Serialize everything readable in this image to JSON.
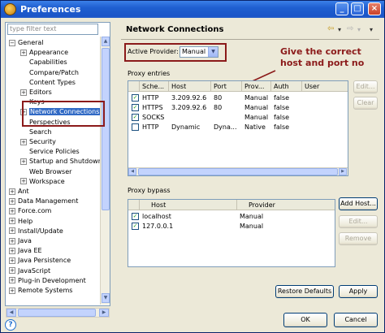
{
  "window": {
    "title": "Preferences",
    "controls": [
      "_",
      "□",
      "×"
    ]
  },
  "filter": {
    "placeholder": "type filter text"
  },
  "tree": [
    {
      "label": "General",
      "level": 0,
      "exp": "−"
    },
    {
      "label": "Appearance",
      "level": 1,
      "exp": "+"
    },
    {
      "label": "Capabilities",
      "level": 1,
      "exp": ""
    },
    {
      "label": "Compare/Patch",
      "level": 1,
      "exp": ""
    },
    {
      "label": "Content Types",
      "level": 1,
      "exp": ""
    },
    {
      "label": "Editors",
      "level": 1,
      "exp": "+"
    },
    {
      "label": "Keys",
      "level": 1,
      "exp": ""
    },
    {
      "label": "Network Connections",
      "level": 1,
      "exp": "+",
      "selected": true
    },
    {
      "label": "Perspectives",
      "level": 1,
      "exp": ""
    },
    {
      "label": "Search",
      "level": 1,
      "exp": ""
    },
    {
      "label": "Security",
      "level": 1,
      "exp": "+"
    },
    {
      "label": "Service Policies",
      "level": 1,
      "exp": ""
    },
    {
      "label": "Startup and Shutdown",
      "level": 1,
      "exp": "+"
    },
    {
      "label": "Web Browser",
      "level": 1,
      "exp": ""
    },
    {
      "label": "Workspace",
      "level": 1,
      "exp": "+"
    },
    {
      "label": "Ant",
      "level": 0,
      "exp": "+"
    },
    {
      "label": "Data Management",
      "level": 0,
      "exp": "+"
    },
    {
      "label": "Force.com",
      "level": 0,
      "exp": "+"
    },
    {
      "label": "Help",
      "level": 0,
      "exp": "+"
    },
    {
      "label": "Install/Update",
      "level": 0,
      "exp": "+"
    },
    {
      "label": "Java",
      "level": 0,
      "exp": "+"
    },
    {
      "label": "Java EE",
      "level": 0,
      "exp": "+"
    },
    {
      "label": "Java Persistence",
      "level": 0,
      "exp": "+"
    },
    {
      "label": "JavaScript",
      "level": 0,
      "exp": "+"
    },
    {
      "label": "Plug-in Development",
      "level": 0,
      "exp": "+"
    },
    {
      "label": "Remote Systems",
      "level": 0,
      "exp": "+"
    }
  ],
  "page": {
    "title": "Network Connections",
    "nav_back": "⇦",
    "nav_back_menu": "▾",
    "nav_fwd": "⇨",
    "nav_fwd_menu": "▾",
    "nav_menu": "▾",
    "provider_label": "Active Provider:",
    "provider_value": "Manual",
    "annotation": "Give the correct host and port no",
    "entries_label": "Proxy entries",
    "entries_columns": [
      "",
      "Sche...",
      "Host",
      "Port",
      "Prov...",
      "Auth",
      "User"
    ],
    "entries_rows": [
      {
        "checked": true,
        "scheme": "HTTP",
        "host": "3.209.92.6",
        "port": "80",
        "provider": "Manual",
        "auth": "false",
        "user": ""
      },
      {
        "checked": true,
        "scheme": "HTTPS",
        "host": "3.209.92.6",
        "port": "80",
        "provider": "Manual",
        "auth": "false",
        "user": ""
      },
      {
        "checked": true,
        "scheme": "SOCKS",
        "host": "",
        "port": "",
        "provider": "Manual",
        "auth": "false",
        "user": ""
      },
      {
        "checked": false,
        "scheme": "HTTP",
        "host": "Dynamic",
        "port": "Dyna...",
        "provider": "Native",
        "auth": "false",
        "user": ""
      }
    ],
    "entries_buttons": {
      "edit": "Edit...",
      "clear": "Clear"
    },
    "bypass_label": "Proxy bypass",
    "bypass_columns": [
      "",
      "Host",
      "Provider"
    ],
    "bypass_rows": [
      {
        "checked": true,
        "host": "localhost",
        "provider": "Manual"
      },
      {
        "checked": true,
        "host": "127.0.0.1",
        "provider": "Manual"
      }
    ],
    "bypass_buttons": {
      "add": "Add Host...",
      "edit": "Edit...",
      "remove": "Remove"
    },
    "restore": "Restore Defaults",
    "apply": "Apply"
  },
  "footer": {
    "help": "?",
    "ok": "OK",
    "cancel": "Cancel"
  },
  "colors": {
    "annotation": "#8b1a1a",
    "selection": "#316ac5",
    "titlebar": "#1f5fd0"
  }
}
